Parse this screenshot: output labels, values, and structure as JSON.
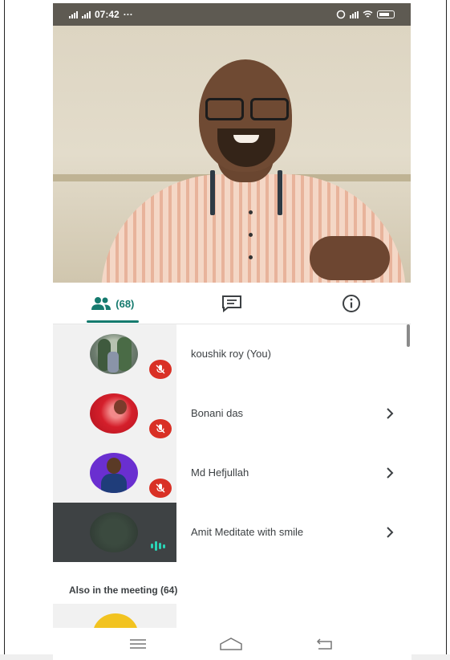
{
  "status_bar": {
    "time": "07:42",
    "overflow_dots": "···"
  },
  "tabs": [
    {
      "icon": "people-icon",
      "label": "(68)",
      "active": true
    },
    {
      "icon": "chat-icon",
      "label": "",
      "active": false
    },
    {
      "icon": "info-icon",
      "label": "",
      "active": false
    }
  ],
  "participants": [
    {
      "name": "koushik roy (You)",
      "muted": true,
      "speaking": false
    },
    {
      "name": "Bonani das",
      "muted": true,
      "speaking": false
    },
    {
      "name": "Md Hefjullah",
      "muted": true,
      "speaking": false
    },
    {
      "name": "Amit Meditate with smile",
      "muted": false,
      "speaking": true
    }
  ],
  "also_in_meeting": "Also in the meeting (64)",
  "colors": {
    "accent": "#157a6e",
    "mute_red": "#d93025",
    "speaking_green": "#2ad4b6"
  },
  "nav_icons": [
    "menu-icon",
    "home-icon",
    "back-icon"
  ]
}
